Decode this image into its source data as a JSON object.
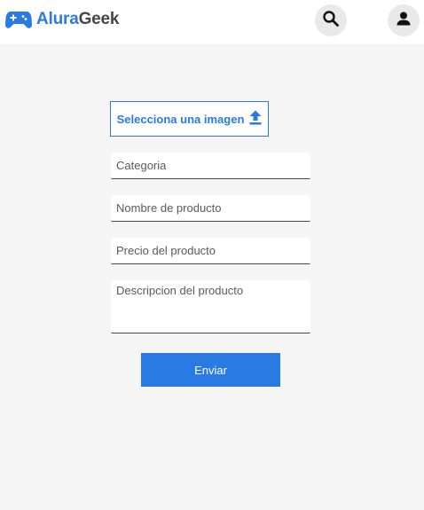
{
  "header": {
    "logo_part1": "Alura",
    "logo_part2": "Geek",
    "logo_icon": "gamepad-icon",
    "search_icon": "search-icon",
    "user_icon": "user-icon"
  },
  "form": {
    "upload_label": "Selecciona una imagen",
    "upload_icon": "upload-icon",
    "category_placeholder": "Categoria",
    "name_placeholder": "Nombre de producto",
    "price_placeholder": "Precio del producto",
    "description_placeholder": "Descripcion del producto",
    "submit_label": "Enviar"
  },
  "colors": {
    "accent": "#2a7ae4",
    "text": "#464646",
    "background": "#f5f5f5"
  }
}
